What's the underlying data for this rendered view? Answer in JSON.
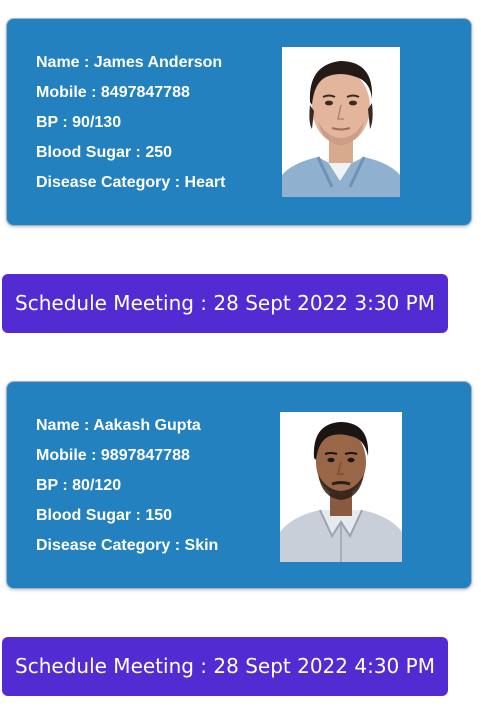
{
  "labels": {
    "name": "Name",
    "mobile": "Mobile",
    "bp": "BP",
    "blood_sugar": "Blood Sugar",
    "disease_category": "Disease Category",
    "separator": " : ",
    "schedule_meeting": "Schedule Meeting : "
  },
  "patients": [
    {
      "name": "James Anderson",
      "mobile": "8497847788",
      "bp": "90/130",
      "blood_sugar": "250",
      "disease_category": "Heart",
      "photo_icon": "patient-photo",
      "meeting": "28 Sept 2022 3:30 PM"
    },
    {
      "name": "Aakash Gupta",
      "mobile": "9897847788",
      "bp": "80/120",
      "blood_sugar": "150",
      "disease_category": "Skin",
      "photo_icon": "patient-photo",
      "meeting": "28 Sept 2022 4:30 PM"
    }
  ],
  "colors": {
    "card_background": "#2281be",
    "button_background": "#532bd3",
    "text": "#ffffff"
  }
}
